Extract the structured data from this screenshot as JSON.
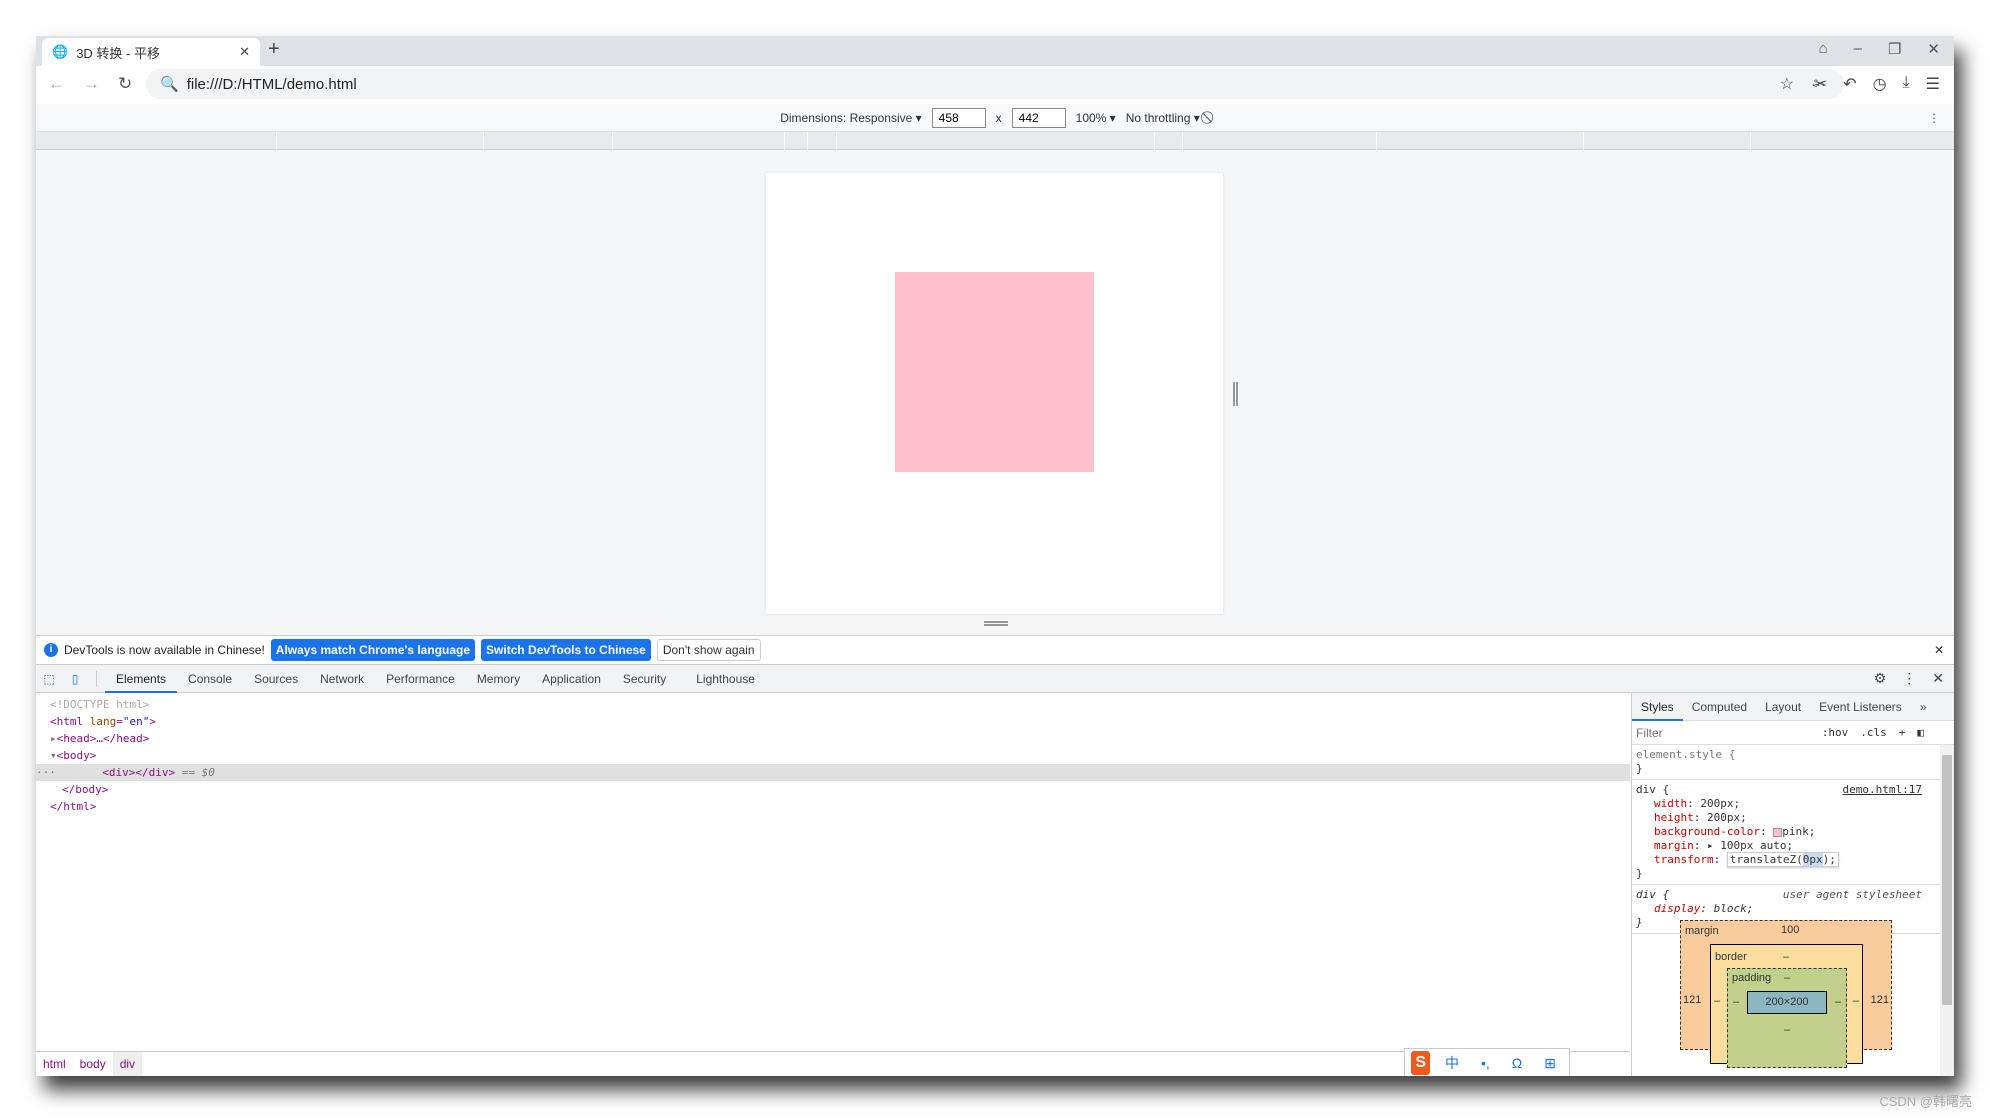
{
  "browser": {
    "tab_title": "3D 转换 - 平移",
    "url": "file:///D:/HTML/demo.html"
  },
  "device_toolbar": {
    "dimensions_label": "Dimensions: Responsive ▾",
    "width": "458",
    "height": "442",
    "times": "x",
    "zoom": "100% ▾",
    "throttling": "No throttling ▾"
  },
  "page": {
    "box_color": "#ffc0cb"
  },
  "infobar": {
    "message": "DevTools is now available in Chinese!",
    "btn_match": "Always match Chrome's language",
    "btn_switch": "Switch DevTools to Chinese",
    "btn_dismiss": "Don't show again"
  },
  "devtools": {
    "tabs": [
      "Elements",
      "Console",
      "Sources",
      "Network",
      "Performance",
      "Memory",
      "Application",
      "Security",
      "Lighthouse"
    ],
    "dom": {
      "doctype": "<!DOCTYPE html>",
      "html_open": "<html",
      "lang_attr": "lang",
      "lang_val": "\"en\"",
      "head": "<head>…</head>",
      "body_open": "<body>",
      "div": "<div></div>",
      "selected_marker": " == $0",
      "body_close": "</body>",
      "html_close": "</html>",
      "dots": "···"
    },
    "breadcrumbs": [
      "html",
      "body",
      "div"
    ]
  },
  "styles": {
    "tabs": [
      "Styles",
      "Computed",
      "Layout",
      "Event Listeners",
      "»"
    ],
    "filter_placeholder": "Filter",
    "hov": ":hov",
    "cls": ".cls",
    "element_style": "element.style {",
    "close": "}",
    "rule1": {
      "selector": "div {",
      "source": "demo.html:17",
      "props": [
        [
          "width",
          "200px;"
        ],
        [
          "height",
          "200px;"
        ],
        [
          "background-color",
          "pink;"
        ],
        [
          "margin",
          "▸ 100px auto;"
        ]
      ],
      "transform_name": "transform",
      "transform_pre": "translateZ(",
      "transform_sel": "0px",
      "transform_post": ");"
    },
    "rule2": {
      "selector": "div {",
      "source": "user agent stylesheet",
      "prop": "display",
      "value": "block;"
    },
    "box_model": {
      "margin_label": "margin",
      "margin_top": "100",
      "border_label": "border",
      "border_top": "–",
      "padding_label": "padding",
      "padding_top": "–",
      "margin_left": "121",
      "margin_right": "121",
      "border_left": "–",
      "border_right": "–",
      "padding_left": "–",
      "padding_right": "–",
      "content": "200×200",
      "padding_bottom": "–"
    }
  },
  "ime": {
    "logo": "S",
    "items": [
      "中",
      "•,",
      "Ω",
      "⊞"
    ]
  },
  "watermark": "CSDN @韩曙亮"
}
